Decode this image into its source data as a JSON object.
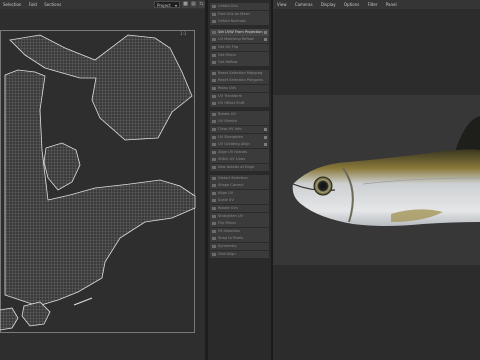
{
  "uv_editor": {
    "menu": [
      "Selection",
      "Fold",
      "Sections"
    ],
    "project_dropdown": "Project",
    "toolbar_icons": [
      "lock-icon",
      "grid-icon",
      "swap-icon"
    ],
    "corner_labels": {
      "top_right": "1:1"
    }
  },
  "modifier_panel": {
    "items": [
      {
        "label": "Unfold UVs",
        "highlight": false,
        "check": false
      },
      {
        "label": "Fold UVs on Mesh",
        "highlight": false,
        "check": false
      },
      {
        "label": "Unfold Normals",
        "highlight": false,
        "check": false
      },
      {
        "label": "Set UVW From Projection",
        "highlight": true,
        "check": true
      },
      {
        "label": "UV Matching Reflow",
        "highlight": false,
        "check": true
      },
      {
        "label": "Get UV Flip",
        "highlight": false,
        "check": false
      },
      {
        "label": "Get Mirror",
        "highlight": false,
        "check": false
      },
      {
        "label": "Get Reflow",
        "highlight": false,
        "check": false
      },
      {
        "label": "Reset Selection Mapping",
        "highlight": false,
        "check": false
      },
      {
        "label": "Reset Selection Polygons",
        "highlight": false,
        "check": false
      },
      {
        "label": "Relax UVs",
        "highlight": false,
        "check": false
      },
      {
        "label": "UV Transform",
        "highlight": false,
        "check": false
      },
      {
        "label": "UV Offset Shift",
        "highlight": false,
        "check": false
      },
      {
        "label": "Rotate UV",
        "highlight": false,
        "check": false
      },
      {
        "label": "UV Stretch",
        "highlight": false,
        "check": false
      },
      {
        "label": "Clear UV Info",
        "highlight": false,
        "check": true
      },
      {
        "label": "UV Straighten",
        "highlight": false,
        "check": true
      },
      {
        "label": "UV Gridding Align",
        "highlight": false,
        "check": true
      },
      {
        "label": "Align UV Islands",
        "highlight": false,
        "check": false
      },
      {
        "label": "Stitch UV Lines",
        "highlight": false,
        "check": false
      },
      {
        "label": "Sew Islands at Edge",
        "highlight": false,
        "check": false
      },
      {
        "label": "Distort Selection",
        "highlight": false,
        "check": false
      },
      {
        "label": "Shape Correct",
        "highlight": false,
        "check": false
      },
      {
        "label": "Align UV",
        "highlight": false,
        "check": false
      },
      {
        "label": "Scale UV",
        "highlight": false,
        "check": false
      },
      {
        "label": "Rotate UVs",
        "highlight": false,
        "check": false
      },
      {
        "label": "Straighten UV",
        "highlight": false,
        "check": false
      },
      {
        "label": "Flip Mirror",
        "highlight": false,
        "check": false
      },
      {
        "label": "Fit Selection",
        "highlight": false,
        "check": false
      },
      {
        "label": "Snap to Pixels",
        "highlight": false,
        "check": false
      },
      {
        "label": "Symmetry",
        "highlight": false,
        "check": false
      },
      {
        "label": "Grid Align",
        "highlight": false,
        "check": false
      }
    ]
  },
  "viewport": {
    "menu": [
      "View",
      "Cameras",
      "Display",
      "Options",
      "Filter",
      "Panel"
    ]
  }
}
